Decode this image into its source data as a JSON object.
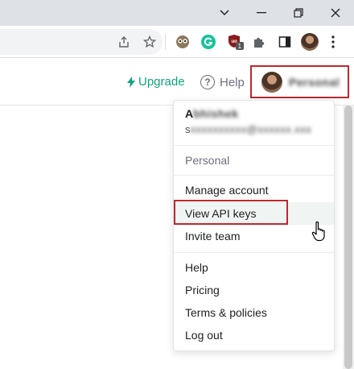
{
  "browser": {
    "controls": {
      "chevron": "⌄",
      "minimize": "—",
      "restore": "❐",
      "close": "✕"
    },
    "extension_badge": "1"
  },
  "header": {
    "upgrade_label": "Upgrade",
    "help_label": "Help",
    "account_name": "Personal",
    "brand_color": "#10a37f",
    "highlight_color": "#c1272d"
  },
  "menu": {
    "user_name_visible": "A",
    "user_name_blurred": "bhishek",
    "user_email_visible": "s",
    "user_email_blurred": "xxxxxxxxxx@xxxxxx.xxx",
    "section_label": "Personal",
    "items_group1": [
      "Manage account",
      "View API keys",
      "Invite team"
    ],
    "items_group2": [
      "Help",
      "Pricing",
      "Terms & policies",
      "Log out"
    ]
  }
}
